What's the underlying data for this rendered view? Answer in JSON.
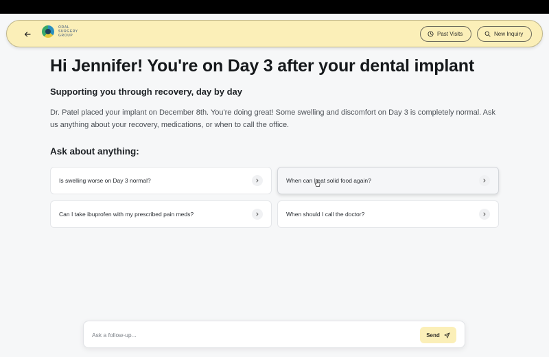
{
  "nav": {
    "back_icon": "arrow-left-icon",
    "logo_lines": [
      "ORAL",
      "SURGERY",
      "GROUP"
    ],
    "past_visits_label": "Past Visits",
    "past_visits_icon": "clock-icon",
    "new_inquiry_label": "New Inquiry",
    "new_inquiry_icon": "search-icon",
    "accent_color": "#fbefb8"
  },
  "main": {
    "greeting": "Hi Jennifer! You're on Day 3 after your dental implant",
    "subheading": "Supporting you through recovery, day by day",
    "intro": "Dr. Patel placed your implant on December 8th. You're doing great! Some swelling and discomfort on Day 3 is completely normal. Ask us anything about your recovery, medications, or when to call the office.",
    "ask_heading": "Ask about anything:",
    "questions": [
      "Is swelling worse on Day 3 normal?",
      "When can I eat solid food again?",
      "Can I take ibuprofen with my prescribed pain meds?",
      "When should I call the doctor?"
    ]
  },
  "composer": {
    "placeholder": "Ask a follow-up...",
    "send_label": "Send",
    "send_icon": "paper-plane-icon"
  }
}
